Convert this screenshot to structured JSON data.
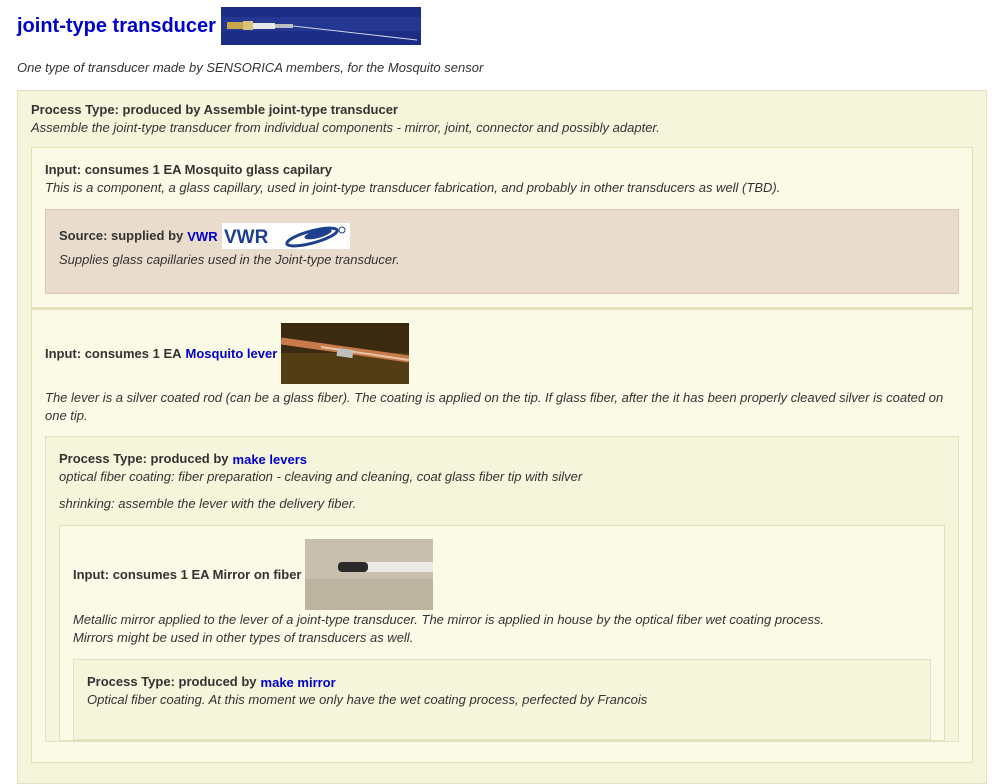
{
  "header": {
    "title": "joint-type transducer",
    "subtitle": "One type of transducer made by SENSORICA members, for the Mosquito sensor"
  },
  "process1": {
    "prefix": "Process Type: produced by Assemble joint-type transducer",
    "desc": "Assemble the joint-type transducer from individual components - mirror, joint, connector and possibly adapter."
  },
  "input1": {
    "label": "Input: consumes 1 EA Mosquito glass capilary",
    "desc": "This is a component, a glass capillary, used in joint-type transducer fabrication, and probably in other transducers as well (TBD)."
  },
  "source1": {
    "prefix": "Source: supplied by",
    "link": "VWR",
    "desc": "Supplies glass capillaries used in the Joint-type transducer."
  },
  "input2": {
    "prefix": "Input: consumes 1 EA",
    "link": "Mosquito lever",
    "desc": "The lever is a silver coated rod (can be a glass fiber). The coating is applied on the tip. If glass fiber, after the it has been properly cleaved silver is coated on one tip."
  },
  "process2": {
    "prefix": "Process Type: produced by",
    "link": "make levers",
    "desc1": "optical fiber coating: fiber preparation - cleaving and cleaning, coat glass fiber tip with silver",
    "desc2": "shrinking: assemble the lever with the delivery fiber."
  },
  "input3": {
    "label": "Input: consumes 1 EA Mirror on fiber",
    "desc1": "Metallic mirror applied to the lever of a joint-type transducer. The mirror is applied in house by the optical fiber wet coating process.",
    "desc2": "Mirrors might be used in other types of transducers as well."
  },
  "process3": {
    "prefix": "Process Type: produced by",
    "link": "make mirror",
    "desc": "Optical fiber coating. At this moment we only have the wet coating process, perfected by Francois"
  }
}
